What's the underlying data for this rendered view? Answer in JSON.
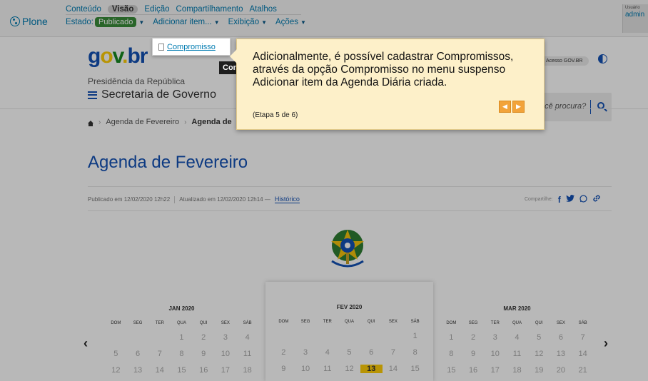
{
  "plone": {
    "logo_label": "Plone",
    "menu": [
      "Conteúdo",
      "Visão",
      "Edição",
      "Compartilhamento",
      "Atalhos"
    ],
    "state_label": "Estado:",
    "state_value": "Publicado",
    "add_item": "Adicionar item...",
    "display": "Exibição",
    "actions": "Ações",
    "user_caption": "Usuário",
    "user_name": "admin"
  },
  "dropdown": {
    "item": "Compromisso",
    "tooltip": "Com"
  },
  "header": {
    "logo_parts": [
      "g",
      "o",
      "v",
      ".",
      "b",
      "r"
    ],
    "presidency": "Presidência da República",
    "secretariat": "Secretaria de Governo",
    "acesso": "Acesso GOV.BR",
    "search_placeholder": "ocê procura?"
  },
  "breadcrumb": [
    "Agenda de Fevereiro",
    "Agenda de"
  ],
  "page": {
    "title": "Agenda de Fevereiro",
    "published": "Publicado em 12/02/2020 12h22",
    "updated": "Atualizado em 12/02/2020 12h14 —",
    "history": "Histórico",
    "share_label": "Compartilhe:",
    "share_icons": [
      "f",
      "t",
      "w",
      "l"
    ]
  },
  "calendars": [
    {
      "title": "JAN 2020",
      "dow": [
        "DOM",
        "SEG",
        "TER",
        "QUA",
        "QUI",
        "SEX",
        "SÁB"
      ],
      "days": [
        "",
        "",
        "",
        "1",
        "2",
        "3",
        "4",
        "5",
        "6",
        "7",
        "8",
        "9",
        "10",
        "11",
        "12",
        "13",
        "14",
        "15",
        "16",
        "17",
        "18"
      ]
    },
    {
      "title": "FEV 2020",
      "dow": [
        "DOM",
        "SEG",
        "TER",
        "QUA",
        "QUI",
        "SEX",
        "SÁB"
      ],
      "days": [
        "",
        "",
        "",
        "",
        "",
        "",
        "1",
        "2",
        "3",
        "4",
        "5",
        "6",
        "7",
        "8",
        "9",
        "10",
        "11",
        "12",
        "13",
        "14",
        "15"
      ],
      "today": "13"
    },
    {
      "title": "MAR 2020",
      "dow": [
        "DOM",
        "SEG",
        "TER",
        "QUA",
        "QUI",
        "SEX",
        "SÁB"
      ],
      "days": [
        "1",
        "2",
        "3",
        "4",
        "5",
        "6",
        "7",
        "8",
        "9",
        "10",
        "11",
        "12",
        "13",
        "14",
        "15",
        "16",
        "17",
        "18",
        "19",
        "20",
        "21"
      ]
    }
  ],
  "tour": {
    "text": "Adicionalmente, é possível cadastrar Compromissos, através da opção Compromisso no menu suspenso Adicionar item da Agenda Diária criada.",
    "step": "(Etapa 5 de 6)"
  }
}
